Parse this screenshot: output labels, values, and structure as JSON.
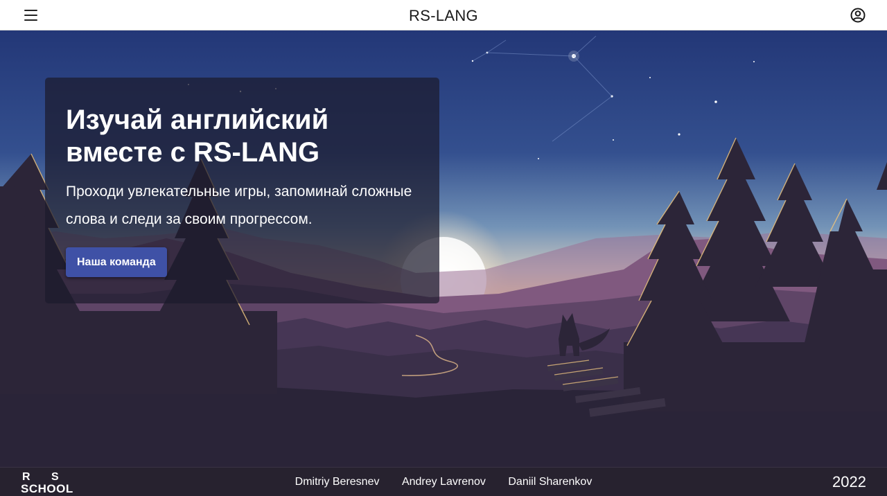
{
  "header": {
    "menu_icon": "hamburger-menu-icon",
    "title": "RS-LANG",
    "user_icon": "account-circle-icon"
  },
  "hero": {
    "title": "Изучай английский вместе с RS-LANG",
    "subtitle": "Проходи увлекательные игры, запоминай сложные слова и следи за своим прогрессом.",
    "team_button": "Наша команда"
  },
  "footer": {
    "logo_r": "R",
    "logo_s": "S",
    "logo_school": "SCHOOL",
    "authors": [
      "Dmitriy Beresnev",
      "Andrey Lavrenov",
      "Daniil Sharenkov"
    ],
    "year": "2022"
  },
  "colors": {
    "sky_top": "#253a7c",
    "sky_horizon": "#f2d8b0",
    "ground": "#2a2438",
    "button": "#3f51a6",
    "header_bg": "#ffffff",
    "footer_bg": "#27222f"
  }
}
